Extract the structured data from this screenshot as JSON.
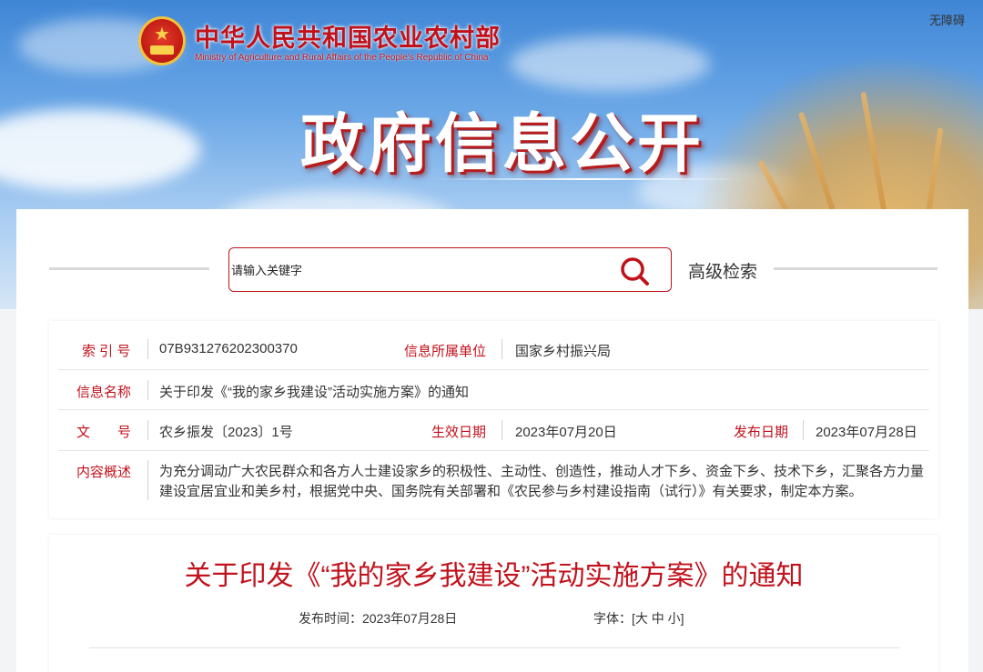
{
  "header": {
    "ministry_cn": "中华人民共和国农业农村部",
    "ministry_en": "Ministry of Agriculture and Rural Affairs of the People's Republic of China",
    "accessibility": "无障碍",
    "hero_title": "政府信息公开"
  },
  "search": {
    "placeholder": "请输入关键字",
    "advanced_label": "高级检索"
  },
  "info": {
    "index_label": "索 引 号",
    "index_value": "07B931276202300370",
    "unit_label": "信息所属单位",
    "unit_value": "国家乡村振兴局",
    "name_label": "信息名称",
    "name_value": "关于印发《“我的家乡我建设”活动实施方案》的通知",
    "doc_label": "文　　号",
    "doc_value": "农乡振发〔2023〕1号",
    "effective_label": "生效日期",
    "effective_value": "2023年07月20日",
    "publish_label": "发布日期",
    "publish_value": "2023年07月28日",
    "summary_label": "内容概述",
    "summary_value": "为充分调动广大农民群众和各方人士建设家乡的积极性、主动性、创造性，推动人才下乡、资金下乡、技术下乡，汇聚各方力量建设宜居宜业和美乡村，根据党中央、国务院有关部署和《农民参与乡村建设指南（试行）》有关要求，制定本方案。"
  },
  "article": {
    "title": "关于印发《“我的家乡我建设”活动实施方案》的通知",
    "publish_time_label": "发布时间：",
    "publish_time_value": "2023年07月28日",
    "font_label": "字体：",
    "font_open": "[",
    "font_large": "大",
    "font_medium": "中",
    "font_small": "小",
    "font_close": "]"
  },
  "colors": {
    "accent_red": "#c1121c",
    "label_red": "#c1121c"
  }
}
